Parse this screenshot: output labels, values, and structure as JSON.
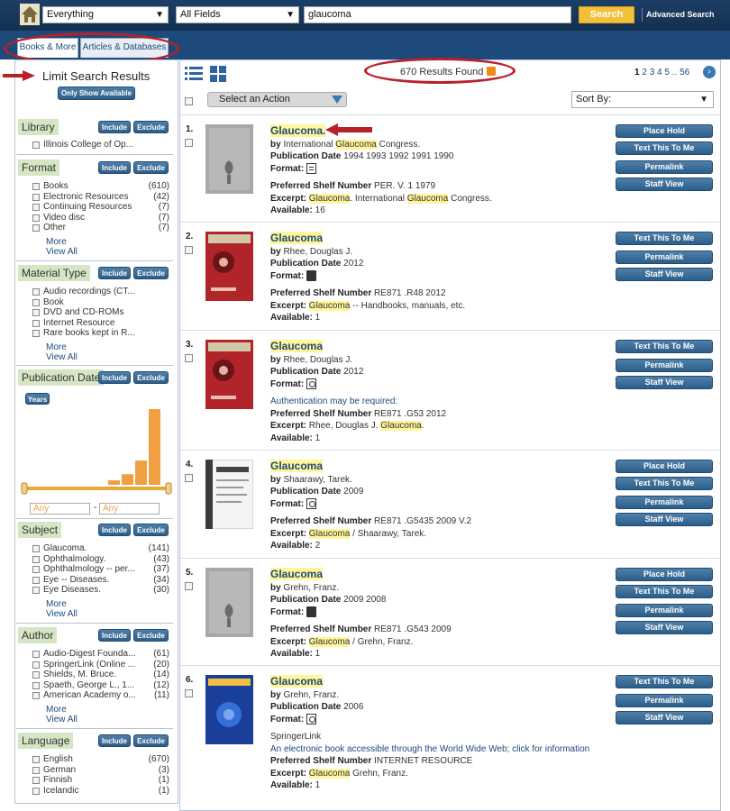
{
  "search": {
    "scope": "Everything",
    "field": "All Fields",
    "query": "glaucoma",
    "button": "Search",
    "advanced": "Advanced Search"
  },
  "tabs": [
    "Books & More",
    "Articles & Databases"
  ],
  "sidebar": {
    "title": "Limit Search Results",
    "only_available": "Only Show Available",
    "include": "Include",
    "exclude": "Exclude",
    "more": "More",
    "view_all": "View All",
    "library": {
      "title": "Library",
      "items": [
        {
          "label": "Illinois College of Op...",
          "count": ""
        }
      ]
    },
    "format": {
      "title": "Format",
      "items": [
        {
          "label": "Books",
          "count": "(610)"
        },
        {
          "label": "Electronic Resources",
          "count": "(42)"
        },
        {
          "label": "Continuing Resources",
          "count": "(7)"
        },
        {
          "label": "Video disc",
          "count": "(7)"
        },
        {
          "label": "Other",
          "count": "(7)"
        }
      ]
    },
    "material": {
      "title": "Material Type",
      "items": [
        {
          "label": "Audio recordings (CT...",
          "count": ""
        },
        {
          "label": "Book",
          "count": ""
        },
        {
          "label": "DVD and CD-ROMs",
          "count": ""
        },
        {
          "label": "Internet Resource",
          "count": ""
        },
        {
          "label": "Rare books kept in R...",
          "count": ""
        }
      ]
    },
    "pubdate": {
      "title": "Publication Date",
      "years": "Years",
      "from": "Any",
      "to": "Any",
      "bars": [
        0.06,
        0.14,
        0.32,
        1.0
      ]
    },
    "subject": {
      "title": "Subject",
      "items": [
        {
          "label": "Glaucoma.",
          "count": "(141)"
        },
        {
          "label": "Ophthalmology.",
          "count": "(43)"
        },
        {
          "label": "Ophthalmology -- per...",
          "count": "(37)"
        },
        {
          "label": "Eye -- Diseases.",
          "count": "(34)"
        },
        {
          "label": "Eye Diseases.",
          "count": "(30)"
        }
      ]
    },
    "author": {
      "title": "Author",
      "items": [
        {
          "label": "Audio-Digest Founda...",
          "count": "(61)"
        },
        {
          "label": "SpringerLink (Online ...",
          "count": "(20)"
        },
        {
          "label": "Shields, M. Bruce.",
          "count": "(14)"
        },
        {
          "label": "Spaeth, George L., 1...",
          "count": "(12)"
        },
        {
          "label": "American Academy o...",
          "count": "(11)"
        }
      ]
    },
    "language": {
      "title": "Language",
      "items": [
        {
          "label": "English",
          "count": "(670)"
        },
        {
          "label": "German",
          "count": "(3)"
        },
        {
          "label": "Finnish",
          "count": "(1)"
        },
        {
          "label": "Icelandic",
          "count": "(1)"
        }
      ]
    }
  },
  "results": {
    "count": "670 Results Found",
    "pages": [
      "1",
      "2",
      "3",
      "4",
      "5",
      "..",
      "56"
    ],
    "action": "Select an Action",
    "sort": "Sort By:",
    "labels": {
      "by": "by",
      "pubdate": "Publication Date",
      "format": "Format:",
      "shelf": "Preferred Shelf Number",
      "excerpt": "Excerpt:",
      "available": "Available:"
    },
    "buttons": {
      "hold": "Place Hold",
      "text": "Text This To Me",
      "permalink": "Permalink",
      "staff": "Staff View"
    },
    "items": [
      {
        "num": "1.",
        "title": "Glaucoma.",
        "author_pre": "International ",
        "author_hl": "Glaucoma",
        "author_post": " Congress.",
        "date": "1994 1993 1992 1991 1990",
        "shelf": "PER. V. 1 1979",
        "excerpt_parts": [
          {
            "t": "Glaucoma",
            "h": true
          },
          {
            "t": ". International ",
            "h": false
          },
          {
            "t": "Glaucoma",
            "h": true
          },
          {
            "t": " Congress.",
            "h": false
          }
        ],
        "available": "16",
        "note": "",
        "extra": ""
      },
      {
        "num": "2.",
        "title": "Glaucoma",
        "author_pre": "Rhee, Douglas J.",
        "author_hl": "",
        "author_post": "",
        "date": "2012",
        "shelf": "RE871 .R48 2012",
        "excerpt_parts": [
          {
            "t": "Glaucoma",
            "h": true
          },
          {
            "t": " -- Handbooks, manuals, etc.",
            "h": false
          }
        ],
        "available": "1",
        "note": "",
        "extra": ""
      },
      {
        "num": "3.",
        "title": "Glaucoma",
        "author_pre": "Rhee, Douglas J.",
        "author_hl": "",
        "author_post": "",
        "date": "2012",
        "shelf": "RE871 .G53 2012",
        "excerpt_parts": [
          {
            "t": "Rhee, Douglas J. ",
            "h": false
          },
          {
            "t": "Glaucoma",
            "h": true
          },
          {
            "t": ".",
            "h": false
          }
        ],
        "available": "1",
        "note": "Authentication may be required:",
        "extra": ""
      },
      {
        "num": "4.",
        "title": "Glaucoma",
        "author_pre": "Shaarawy, Tarek.",
        "author_hl": "",
        "author_post": "",
        "date": "2009",
        "shelf": "RE871 .G5435 2009 V.2",
        "excerpt_parts": [
          {
            "t": "Glaucoma",
            "h": true
          },
          {
            "t": " / Shaarawy, Tarek.",
            "h": false
          }
        ],
        "available": "2",
        "note": "",
        "extra": ""
      },
      {
        "num": "5.",
        "title": "Glaucoma",
        "author_pre": "Grehn, Franz.",
        "author_hl": "",
        "author_post": "",
        "date": "2009 2008",
        "shelf": "RE871 .G543 2009",
        "excerpt_parts": [
          {
            "t": "Glaucoma",
            "h": true
          },
          {
            "t": " / Grehn, Franz.",
            "h": false
          }
        ],
        "available": "1",
        "note": "",
        "extra": ""
      },
      {
        "num": "6.",
        "title": "Glaucoma",
        "author_pre": "Grehn, Franz.",
        "author_hl": "",
        "author_post": "",
        "date": "2006",
        "shelf": "INTERNET RESOURCE",
        "excerpt_parts": [
          {
            "t": "Glaucoma",
            "h": true
          },
          {
            "t": " Grehn, Franz.",
            "h": false
          }
        ],
        "available": "1",
        "note": "SpringerLink",
        "extra": "An electronic book accessible through the World Wide Web; click for information"
      }
    ]
  },
  "colors": {
    "accent": "#f3c03a",
    "link": "#1d4a7a",
    "annotation": "#b8202a",
    "highlight": "#fff59a"
  }
}
